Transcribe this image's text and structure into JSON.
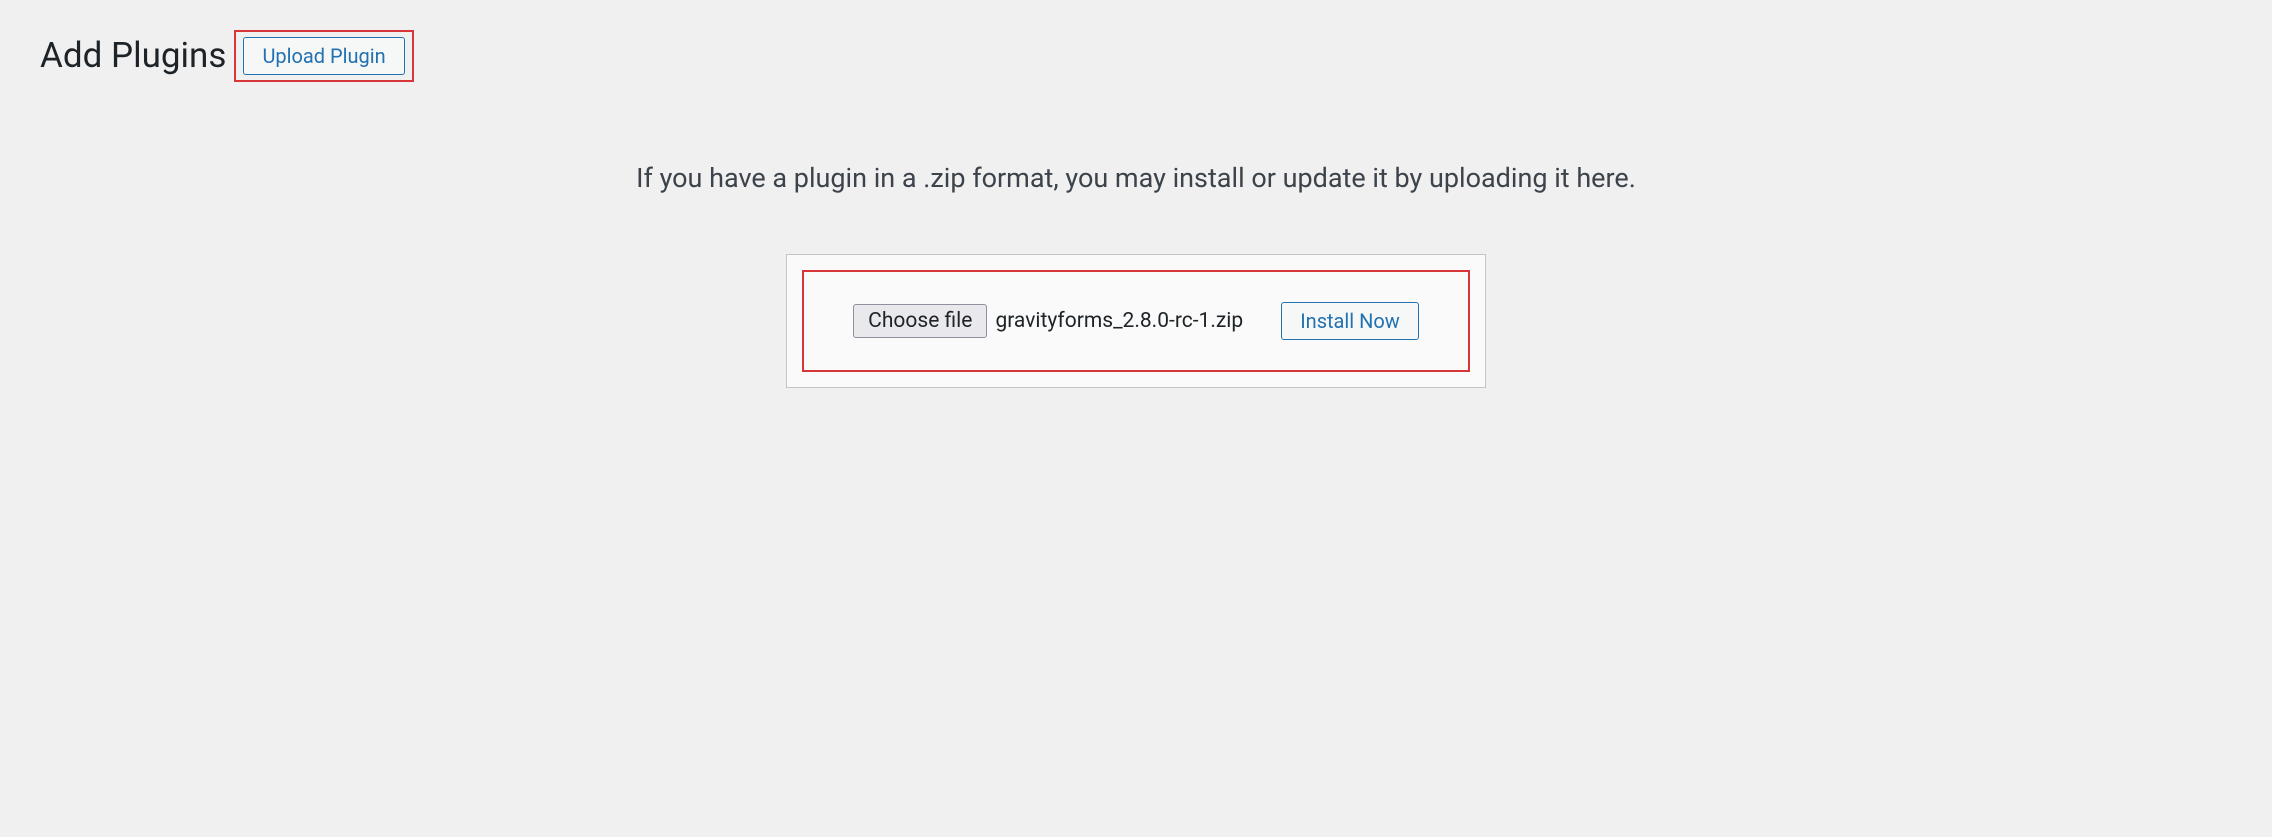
{
  "header": {
    "title": "Add Plugins",
    "upload_button_label": "Upload Plugin"
  },
  "upload": {
    "help_text": "If you have a plugin in a .zip format, you may install or update it by uploading it here.",
    "choose_file_label": "Choose file",
    "selected_filename": "gravityforms_2.8.0-rc-1.zip",
    "install_button_label": "Install Now"
  }
}
